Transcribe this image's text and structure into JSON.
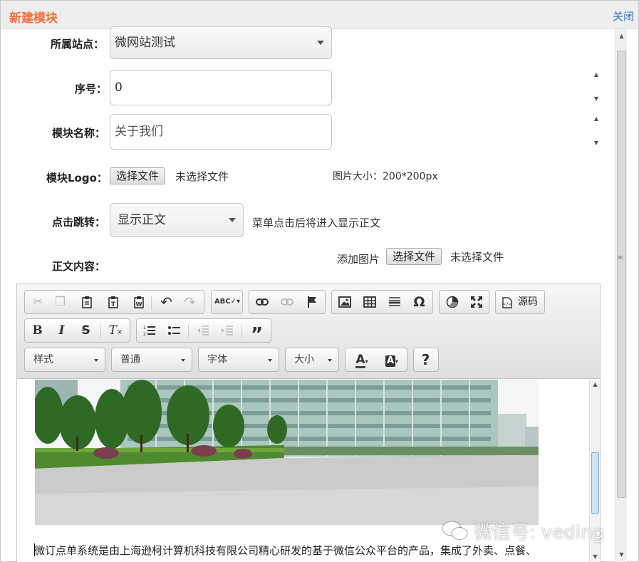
{
  "dialog": {
    "title": "新建模块",
    "close_label": "关闭"
  },
  "form": {
    "site": {
      "label": "所属站点：",
      "value": "微网站测试"
    },
    "order": {
      "label": "序号：",
      "value": "0"
    },
    "name": {
      "label": "模块名称：",
      "placeholder": "关于我们"
    },
    "logo": {
      "label": "模块Logo：",
      "button": "选择文件",
      "status": "未选择文件",
      "hint": "图片大小：200*200px"
    },
    "jump": {
      "label": "点击跳转：",
      "value": "显示正文",
      "hint": "菜单点击后将进入显示正文"
    },
    "body": {
      "label": "正文内容：",
      "add_image_label": "添加图片",
      "button": "选择文件",
      "status": "未选择文件"
    }
  },
  "editor": {
    "toolbar_row1": [
      "cut-icon",
      "copy-icon",
      "paste-icon",
      "paste-text-icon",
      "paste-word-icon",
      "undo-icon",
      "redo-icon",
      "spellcheck-icon",
      "link-icon",
      "unlink-icon",
      "anchor-icon",
      "image-icon",
      "table-icon",
      "horizontal-rule-icon",
      "special-char-icon",
      "iframe-icon",
      "maximize-icon",
      "source-icon"
    ],
    "source_label": "源码",
    "toolbar_row2": [
      "bold-icon",
      "italic-icon",
      "strike-icon",
      "remove-format-icon",
      "numbered-list-icon",
      "bulleted-list-icon",
      "outdent-icon",
      "indent-icon",
      "blockquote-icon"
    ],
    "combos": {
      "styles": "样式",
      "format": "普通",
      "font": "字体",
      "size": "大小"
    },
    "help_label": "?",
    "content_text": "微订点单系统是由上海逊柯计算机科技有限公司精心研发的基于微信公众平台的产品，集成了外卖、点餐、"
  },
  "watermark": "微信号: veding",
  "colors": {
    "title": "#f0703c",
    "link": "#2a6fc9",
    "toolbar_bg": "#e6e6e6"
  }
}
